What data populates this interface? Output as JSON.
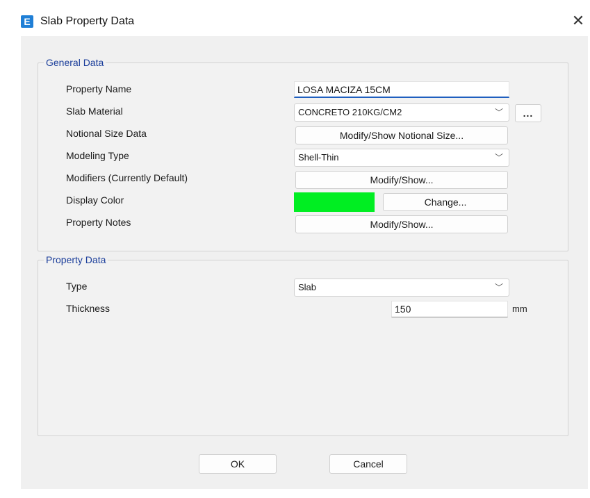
{
  "window": {
    "app_icon_letter": "E",
    "title": "Slab Property Data",
    "close_glyph": "✕"
  },
  "general": {
    "legend": "General Data",
    "property_name": {
      "label": "Property Name",
      "value": "LOSA MACIZA 15CM"
    },
    "slab_material": {
      "label": "Slab Material",
      "value": "CONCRETO 210KG/CM2",
      "more_label": "..."
    },
    "notional_size": {
      "label": "Notional Size Data",
      "button": "Modify/Show Notional Size..."
    },
    "modeling_type": {
      "label": "Modeling Type",
      "value": "Shell-Thin"
    },
    "modifiers": {
      "label": "Modifiers (Currently Default)",
      "button": "Modify/Show..."
    },
    "display_color": {
      "label": "Display Color",
      "color": "#00ee22",
      "button": "Change..."
    },
    "property_notes": {
      "label": "Property Notes",
      "button": "Modify/Show..."
    }
  },
  "property": {
    "legend": "Property Data",
    "type": {
      "label": "Type",
      "value": "Slab"
    },
    "thickness": {
      "label": "Thickness",
      "value": "150",
      "units": "mm"
    }
  },
  "footer": {
    "ok": "OK",
    "cancel": "Cancel"
  },
  "icons": {
    "dropdown": "chevron-down-icon"
  }
}
